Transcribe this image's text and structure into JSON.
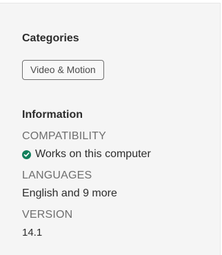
{
  "categories": {
    "title": "Categories",
    "tags": [
      "Video & Motion"
    ]
  },
  "information": {
    "title": "Information",
    "compatibility": {
      "label": "COMPATIBILITY",
      "value": "Works on this computer",
      "icon": "check-circle-icon",
      "icon_color": "#12805c"
    },
    "languages": {
      "label": "LANGUAGES",
      "value": "English and 9 more"
    },
    "version": {
      "label": "VERSION",
      "value": "14.1"
    }
  }
}
